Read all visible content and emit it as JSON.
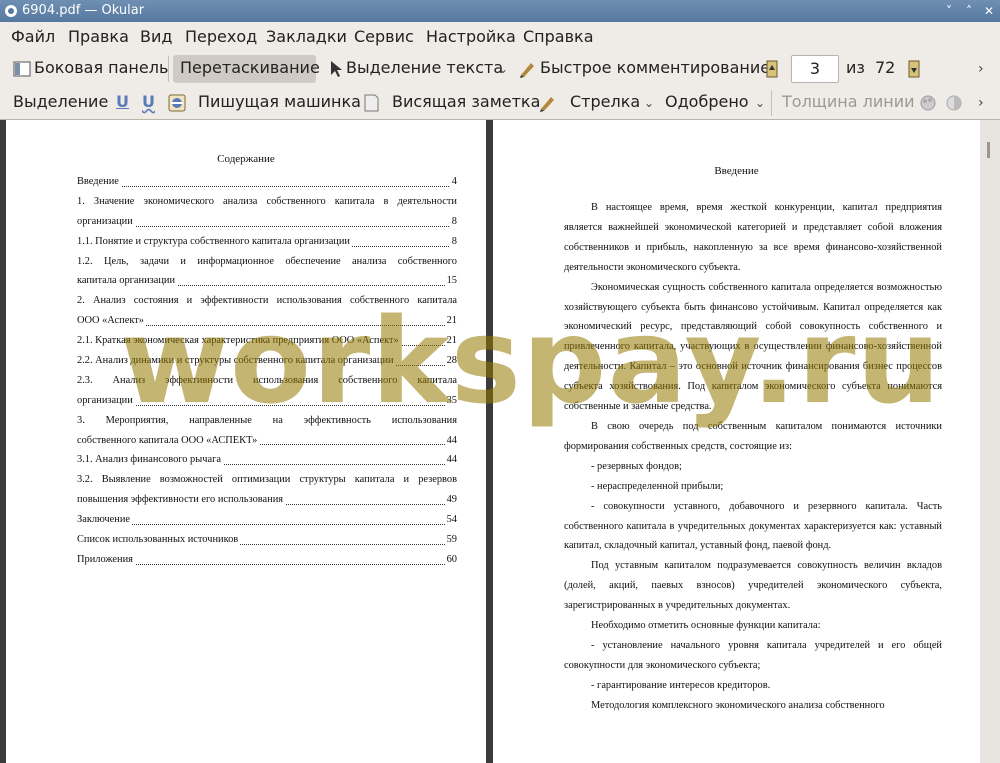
{
  "window": {
    "title": "6904.pdf  — Okular",
    "controls": [
      "˅",
      "˄",
      "✕"
    ]
  },
  "menu": [
    "Файл",
    "Правка",
    "Вид",
    "Переход",
    "Закладки",
    "Сервис",
    "Настройка",
    "Справка"
  ],
  "toolbar1": {
    "sidebar": "Боковая панель",
    "browse": "Перетаскивание",
    "text_select": "Выделение текста",
    "quick_comment": "Быстрое комментирование",
    "page_current": "3",
    "page_of": "из",
    "page_total": "72"
  },
  "toolbar2": {
    "selection": "Выделение",
    "typewriter": "Пишущая машинка",
    "sticky_note": "Висящая заметка",
    "arrow": "Стрелка",
    "approved": "Одобрено",
    "line_width": "Толщина линии"
  },
  "left_page": {
    "title": "Содержание",
    "toc": [
      {
        "text": "Введение",
        "page": "4"
      },
      {
        "first": "1.  Значение экономического анализа собственного капитала в деятельности",
        "text": "организации",
        "page": "8"
      },
      {
        "text": "1.1. Понятие и структура собственного капитала организации",
        "page": "8"
      },
      {
        "first": "1.2.  Цель, задачи и информационное обеспечение анализа собственного",
        "text": "капитала организации",
        "page": "15"
      },
      {
        "first": "2. Анализ состояния и эффективности использования собственного капитала",
        "text": "ООО «Аспект»",
        "page": "21"
      },
      {
        "text": "2.1. Краткая экономическая характеристика предприятия ООО «Аспект»",
        "page": "21"
      },
      {
        "text": "2.2. Анализ динамики и структуры собственного капитала организации",
        "page": "28"
      },
      {
        "first": "2.3.   Анализ   эффективности   использования   собственного   капитала",
        "text": "организации",
        "page": "35"
      },
      {
        "first": "3.   Мероприятия,   направленные   на   эффективность   использования",
        "text": "собственного капитала ООО «АСПЕКТ»",
        "page": "44"
      },
      {
        "text": "3.1. Анализ финансового рычага",
        "page": "44"
      },
      {
        "first": "3.2. Выявление возможностей оптимизации структуры капитала и резервов",
        "text": "повышения эффективности его использования",
        "page": "49"
      },
      {
        "text": "Заключение",
        "page": "54"
      },
      {
        "text": "Список использованных источников",
        "page": "59"
      },
      {
        "text": "Приложения",
        "page": "60"
      }
    ]
  },
  "right_page": {
    "title": "Введение",
    "paragraphs": [
      "В настоящее время, время жесткой конкуренции, капитал предприятия является важнейшей экономической категорией и представляет собой вложения собственников и прибыль, накопленную за все время финансово-хозяйственной деятельности экономического субъекта.",
      "Экономическая сущность собственного капитала определяется возможностью хозяйствующего субъекта быть финансово устойчивым. Капитал определяется как экономический ресурс, представляющий собой совокупность собственного и привлеченного капитала, участвующих в осуществлении финансово-хозяйственной деятельности. Капитал – это основной источник финансирования бизнес процессов субъекта хозяйствования. Под капиталом экономического субъекта понимаются собственные и заемные средства.",
      "В свою очередь под собственным капиталом понимаются источники формирования собственных средств, состоящие из:",
      "- резервных фондов;",
      "- нераспределенной прибыли;",
      "- совокупности уставного, добавочного и резервного капитала. Часть собственного капитала в учредительных документах характеризуется как: уставный капитал, складочный капитал, уставный фонд, паевой фонд.",
      "Под уставным капиталом подразумевается совокупность величин вкладов (долей, акций, паевых взносов) учредителей экономического субъекта, зарегистрированных в учредительных документах.",
      "Необходимо отметить основные функции капитала:",
      "- установление начального уровня капитала учредителей и его общей совокупности для экономического субъекта;",
      "- гарантирование интересов кредиторов.",
      "Методология комплексного экономического анализа собственного"
    ]
  },
  "watermark": "workspay.ru"
}
